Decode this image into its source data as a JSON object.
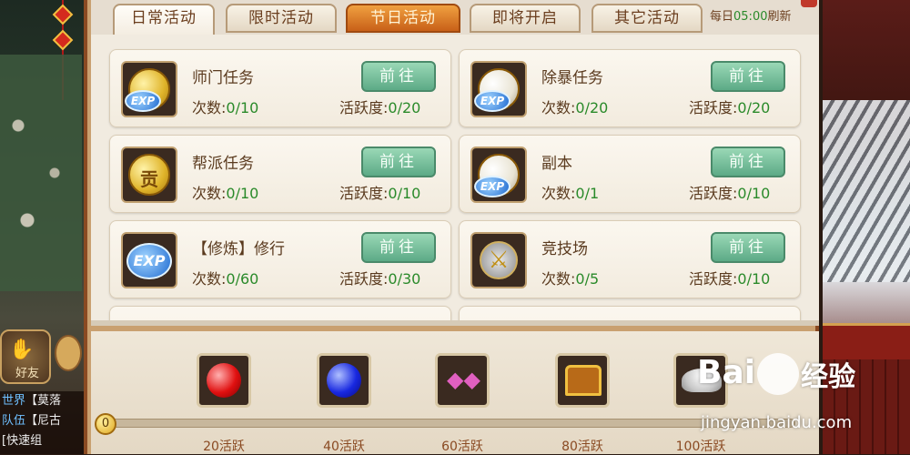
{
  "tabs": [
    {
      "label": "日常活动"
    },
    {
      "label": "限时活动"
    },
    {
      "label": "节日活动"
    },
    {
      "label": "即将开启"
    },
    {
      "label": "其它活动"
    }
  ],
  "refresh": {
    "prefix": "每日",
    "time": "05:00",
    "suffix": "刷新"
  },
  "activities": [
    {
      "name": "师门任务",
      "count_label": "次数:",
      "count": "0/10",
      "act_label": "活跃度:",
      "act": "0/20",
      "button": "前往",
      "icon": "gold-coin-exp-icon"
    },
    {
      "name": "除暴任务",
      "count_label": "次数:",
      "count": "0/20",
      "act_label": "活跃度:",
      "act": "0/20",
      "button": "前往",
      "icon": "silver-coin-exp-icon"
    },
    {
      "name": "帮派任务",
      "count_label": "次数:",
      "count": "0/10",
      "act_label": "活跃度:",
      "act": "0/10",
      "button": "前往",
      "icon": "contribution-coin-icon",
      "coin_glyph": "贡"
    },
    {
      "name": "副本",
      "count_label": "次数:",
      "count": "0/1",
      "act_label": "活跃度:",
      "act": "0/10",
      "button": "前往",
      "icon": "taiji-exp-icon"
    },
    {
      "name": "【修炼】修行",
      "count_label": "次数:",
      "count": "0/60",
      "act_label": "活跃度:",
      "act": "0/30",
      "button": "前往",
      "icon": "exp-icon",
      "exp_text": "EXP"
    },
    {
      "name": "竞技场",
      "count_label": "次数:",
      "count": "0/5",
      "act_label": "活跃度:",
      "act": "0/10",
      "button": "前往",
      "icon": "crossed-swords-icon"
    }
  ],
  "exp_badge": "EXP",
  "rewards": {
    "start_value": "0",
    "milestones": [
      {
        "label": "20活跃",
        "icon": "red-orb-icon"
      },
      {
        "label": "40活跃",
        "icon": "blue-orb-icon"
      },
      {
        "label": "60活跃",
        "icon": "pink-gems-icon"
      },
      {
        "label": "80活跃",
        "icon": "treasure-chest-icon"
      },
      {
        "label": "100活跃",
        "icon": "silver-ingot-icon"
      }
    ]
  },
  "side": {
    "friend_label": "好友",
    "chat": [
      {
        "tag": "世界",
        "text": "【莫落"
      },
      {
        "tag": "队伍",
        "text": "【尼古"
      },
      {
        "tag": "",
        "text": "[快速组"
      }
    ]
  },
  "watermark": {
    "brand_left": "Bai",
    "brand_cn": "经验",
    "url": "jingyan.baidu.com"
  },
  "colors": {
    "progress_value": "#2a8a2a",
    "festival_tab": "#e07828",
    "go_button": "#6cb892"
  }
}
